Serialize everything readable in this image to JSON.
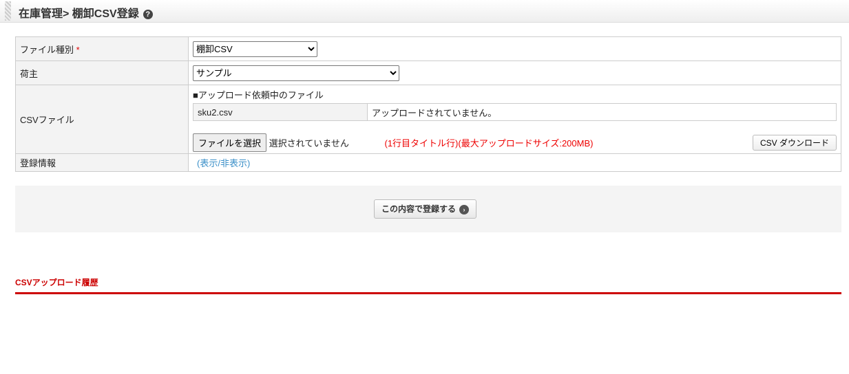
{
  "header": {
    "title": "在庫管理> 棚卸CSV登録",
    "help_icon": "?"
  },
  "form": {
    "file_type": {
      "label": "ファイル種別",
      "required": "*",
      "value": "棚卸CSV"
    },
    "shipper": {
      "label": "荷主",
      "value": "サンプル"
    },
    "csv": {
      "label": "CSVファイル",
      "pending_heading": "■アップロード依頼中のファイル",
      "pending_file": "sku2.csv",
      "pending_status": "アップロードされていません。",
      "choose_button": "ファイルを選択",
      "no_file": "選択されていません",
      "note": "(1行目タイトル行)(最大アップロードサイズ:200MB)",
      "download_button": "CSV ダウンロード"
    },
    "reg_info": {
      "label": "登録情報",
      "open": "(",
      "link": "表示/非表示",
      "close": ")"
    }
  },
  "submit": {
    "label": "この内容で登録する",
    "icon": "›"
  },
  "history": {
    "title": "CSVアップロード履歴"
  }
}
